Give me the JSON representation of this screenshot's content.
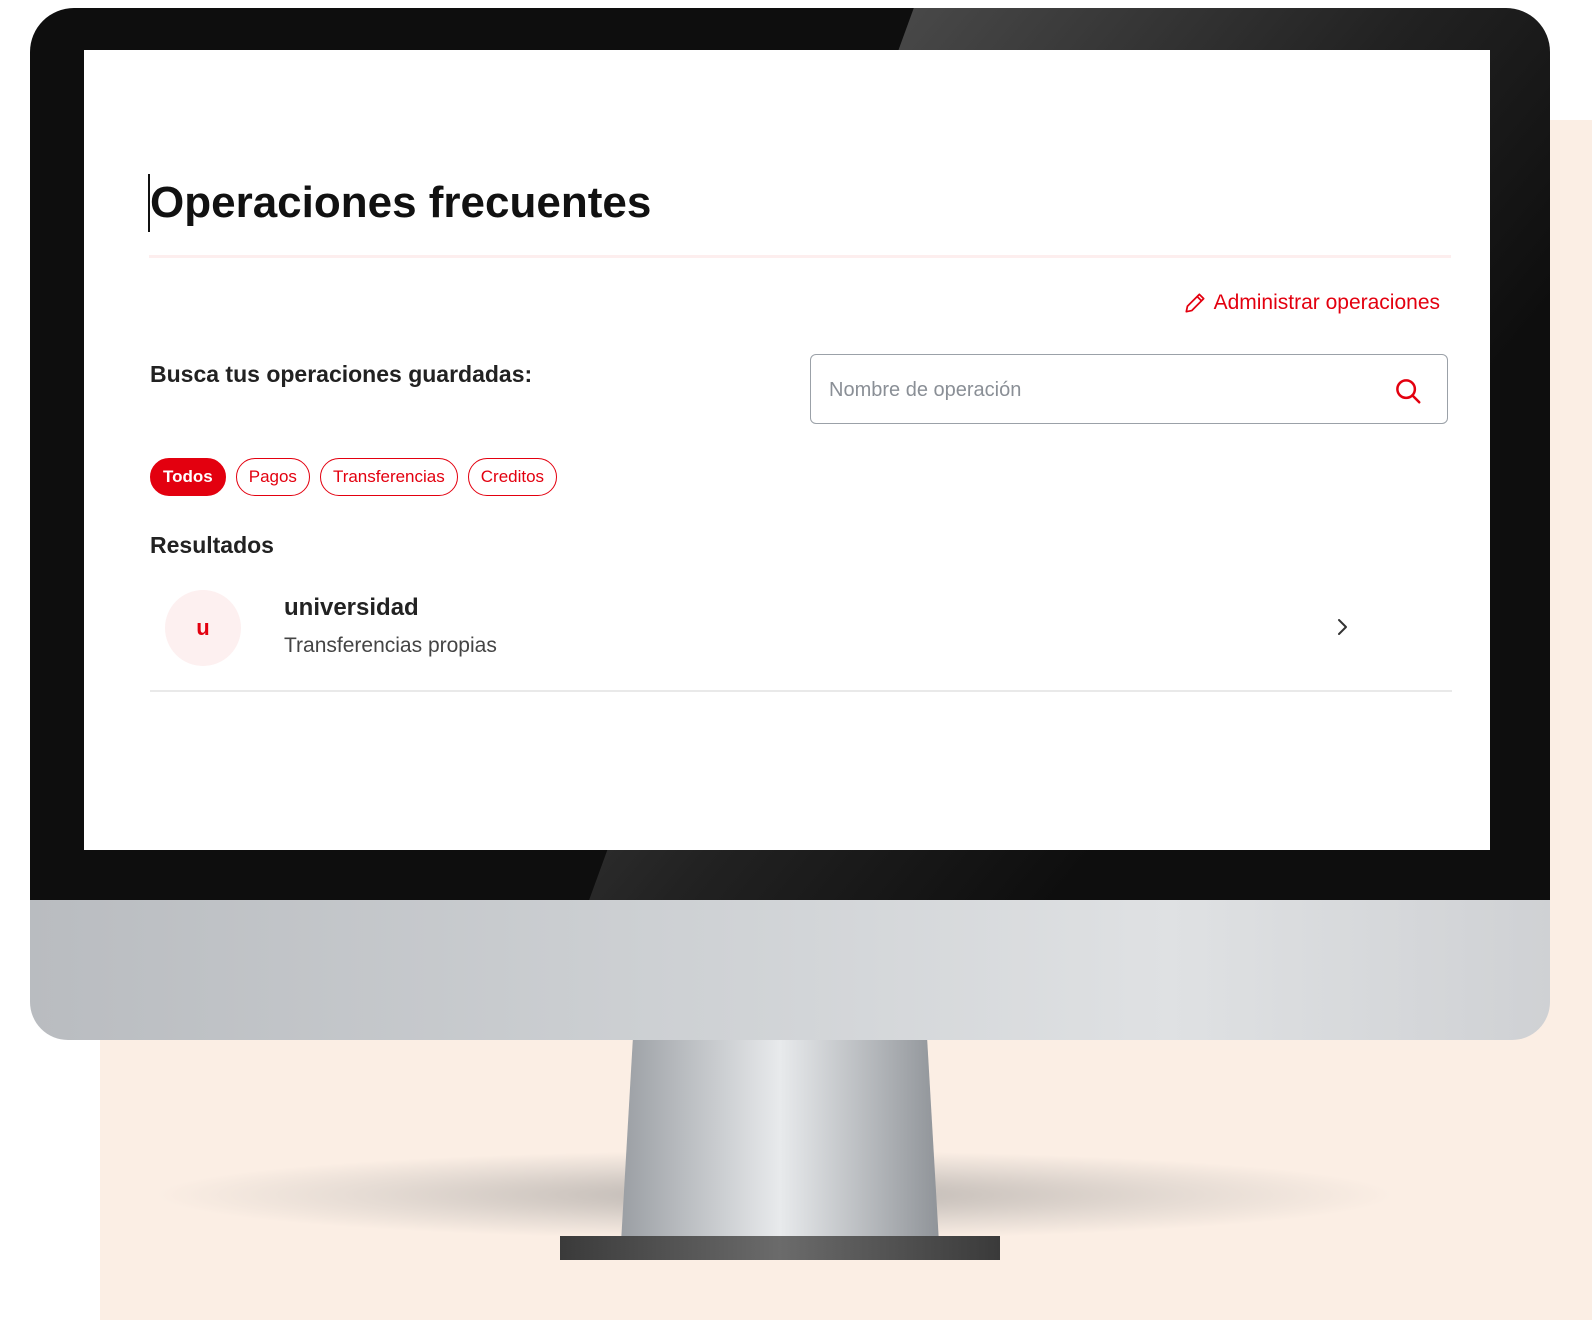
{
  "page": {
    "title": "Operaciones frecuentes",
    "manage_link": "Administrar operaciones"
  },
  "search": {
    "label": "Busca tus operaciones guardadas:",
    "placeholder": "Nombre de operación",
    "value": ""
  },
  "filters": [
    {
      "label": "Todos",
      "active": true
    },
    {
      "label": "Pagos",
      "active": false
    },
    {
      "label": "Transferencias",
      "active": false
    },
    {
      "label": "Creditos",
      "active": false
    }
  ],
  "results": {
    "heading": "Resultados",
    "items": [
      {
        "initial": "u",
        "title": "universidad",
        "subtitle": "Transferencias propias"
      }
    ]
  },
  "icons": {
    "manage": "pencil-icon",
    "search": "search-icon",
    "open": "chevron-right-icon"
  },
  "colors": {
    "accent": "#e3000f",
    "avatar_bg": "#fdf0f0",
    "background_blob": "#fbeee4"
  }
}
